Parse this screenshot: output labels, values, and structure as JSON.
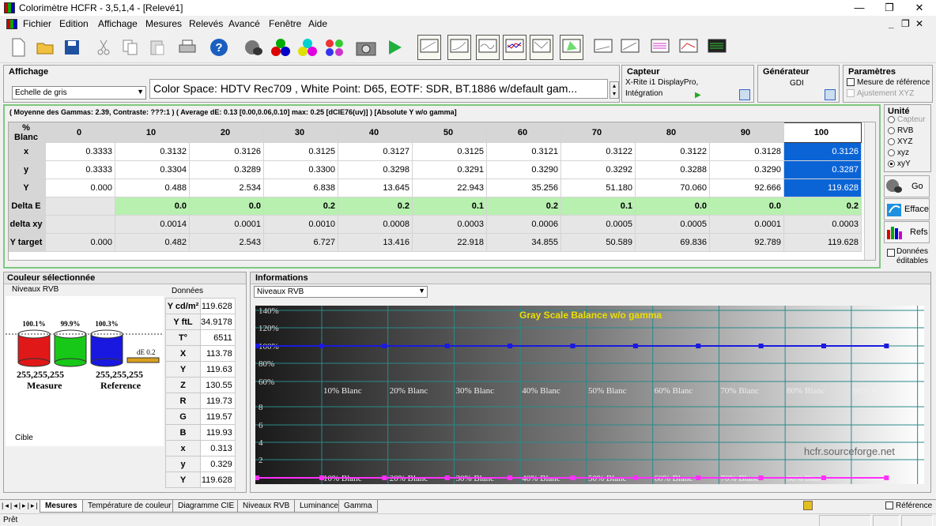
{
  "window": {
    "title": "Colorimètre HCFR - 3,5,1,4 - [Relevé1]",
    "min": "—",
    "max": "❐",
    "close": "✕"
  },
  "menu": {
    "items": [
      "Fichier",
      "Edition",
      "Affichage",
      "Mesures",
      "Relevés",
      "Avancé",
      "Fenêtre",
      "Aide"
    ],
    "mdi_min": "_",
    "mdi_restore": "❐",
    "mdi_close": "✕"
  },
  "affichage": {
    "header": "Affichage",
    "select": "Echelle de gris",
    "info": "Color Space: HDTV Rec709 , White Point: D65, EOTF:  SDR, BT.1886 w/default gam..."
  },
  "capteur": {
    "header": "Capteur",
    "device": "X-Rite i1 DisplayPro,",
    "mode": "Intégration"
  },
  "generateur": {
    "header": "Générateur",
    "value": "GDI"
  },
  "parametres": {
    "header": "Paramètres",
    "opt1": "Mesure de référence",
    "opt2": "Ajustement XYZ"
  },
  "summary": "( Moyenne des Gammas: 2.39, Contraste: ???:1 ) ( Average dE: 0.13 [0.00,0.06,0.10] max: 0.25 [dCIE76(uv)] ) [Absolute Y w/o gamma]",
  "grid": {
    "corner": "% Blanc",
    "columns": [
      "0",
      "10",
      "20",
      "30",
      "40",
      "50",
      "60",
      "70",
      "80",
      "90",
      "100"
    ],
    "rows": [
      {
        "label": "x",
        "values": [
          "0.3333",
          "0.3132",
          "0.3126",
          "0.3125",
          "0.3127",
          "0.3125",
          "0.3121",
          "0.3122",
          "0.3122",
          "0.3128",
          "0.3126"
        ]
      },
      {
        "label": "y",
        "values": [
          "0.3333",
          "0.3304",
          "0.3289",
          "0.3300",
          "0.3298",
          "0.3291",
          "0.3290",
          "0.3292",
          "0.3288",
          "0.3290",
          "0.3287"
        ]
      },
      {
        "label": "Y",
        "values": [
          "0.000",
          "0.488",
          "2.534",
          "6.838",
          "13.645",
          "22.943",
          "35.256",
          "51.180",
          "70.060",
          "92.666",
          "119.628"
        ]
      },
      {
        "label": "Delta E",
        "values": [
          "",
          "0.0",
          "0.0",
          "0.2",
          "0.2",
          "0.1",
          "0.2",
          "0.1",
          "0.0",
          "0.0",
          "0.2"
        ]
      },
      {
        "label": "delta xy",
        "values": [
          "",
          "0.0014",
          "0.0001",
          "0.0010",
          "0.0008",
          "0.0003",
          "0.0006",
          "0.0005",
          "0.0005",
          "0.0001",
          "0.0003"
        ]
      },
      {
        "label": "Y target",
        "values": [
          "0.000",
          "0.482",
          "2.543",
          "6.727",
          "13.416",
          "22.918",
          "34.855",
          "50.589",
          "69.836",
          "92.789",
          "119.628"
        ]
      }
    ]
  },
  "unite": {
    "header": "Unité",
    "options": [
      "Capteur",
      "RVB",
      "XYZ",
      "xyz",
      "xyY"
    ],
    "selected": "xyY"
  },
  "side_buttons": {
    "go": "Go",
    "efface": "Efface",
    "refs": "Refs",
    "donnees": "Données éditables"
  },
  "couleur": {
    "header": "Couleur sélectionnée",
    "sub": "Niveaux RVB",
    "donnees_label": "Données",
    "bars": [
      {
        "pct": "100.1%",
        "color": "#e01818"
      },
      {
        "pct": "99.9%",
        "color": "#18c818"
      },
      {
        "pct": "100.3%",
        "color": "#1818e0"
      }
    ],
    "de": "dE 0.2",
    "measure_rgb": "255,255,255",
    "measure_label": "Measure",
    "ref_rgb": "255,255,255",
    "ref_label": "Reference",
    "cible": "Cible"
  },
  "donnees": [
    {
      "k": "Y cd/m²",
      "v": "119.628"
    },
    {
      "k": "Y ftL",
      "v": "34.9178"
    },
    {
      "k": "T°",
      "v": "6511"
    },
    {
      "k": "X",
      "v": "113.78"
    },
    {
      "k": "Y",
      "v": "119.63"
    },
    {
      "k": "Z",
      "v": "130.55"
    },
    {
      "k": "R",
      "v": "119.73"
    },
    {
      "k": "G",
      "v": "119.57"
    },
    {
      "k": "B",
      "v": "119.93"
    },
    {
      "k": "x",
      "v": "0.313"
    },
    {
      "k": "y",
      "v": "0.329"
    },
    {
      "k": "Y",
      "v": "119.628"
    }
  ],
  "informations": {
    "header": "Informations",
    "select": "Niveaux RVB"
  },
  "chart_data": {
    "type": "line",
    "title": "Gray Scale Balance w/o gamma",
    "watermark": "hcfr.sourceforge.net",
    "y_ticks": [
      "140%",
      "120%",
      "100%",
      "80%",
      "60%",
      "8",
      "6",
      "4",
      "2"
    ],
    "x_labels": [
      "10% Blanc",
      "20% Blanc",
      "30% Blanc",
      "40% Blanc",
      "50% Blanc",
      "60% Blanc",
      "70% Blanc",
      "80% Blanc",
      "90% Blanc"
    ],
    "x": [
      0,
      10,
      20,
      30,
      40,
      50,
      60,
      70,
      80,
      90,
      100
    ],
    "series": [
      {
        "color": "#1a1ae0",
        "values": [
          100,
          100,
          100,
          100,
          100,
          100,
          100,
          100,
          100,
          100,
          100
        ]
      },
      {
        "color": "#ff30ff",
        "values": [
          0,
          0,
          0,
          0,
          0,
          0,
          0,
          0,
          0,
          0,
          0
        ]
      }
    ]
  },
  "tabs": [
    "Mesures",
    "Température de couleur",
    "Diagramme CIE",
    "Niveaux RVB",
    "Luminance",
    "Gamma"
  ],
  "reference_label": "Référence",
  "status": "Prêt"
}
